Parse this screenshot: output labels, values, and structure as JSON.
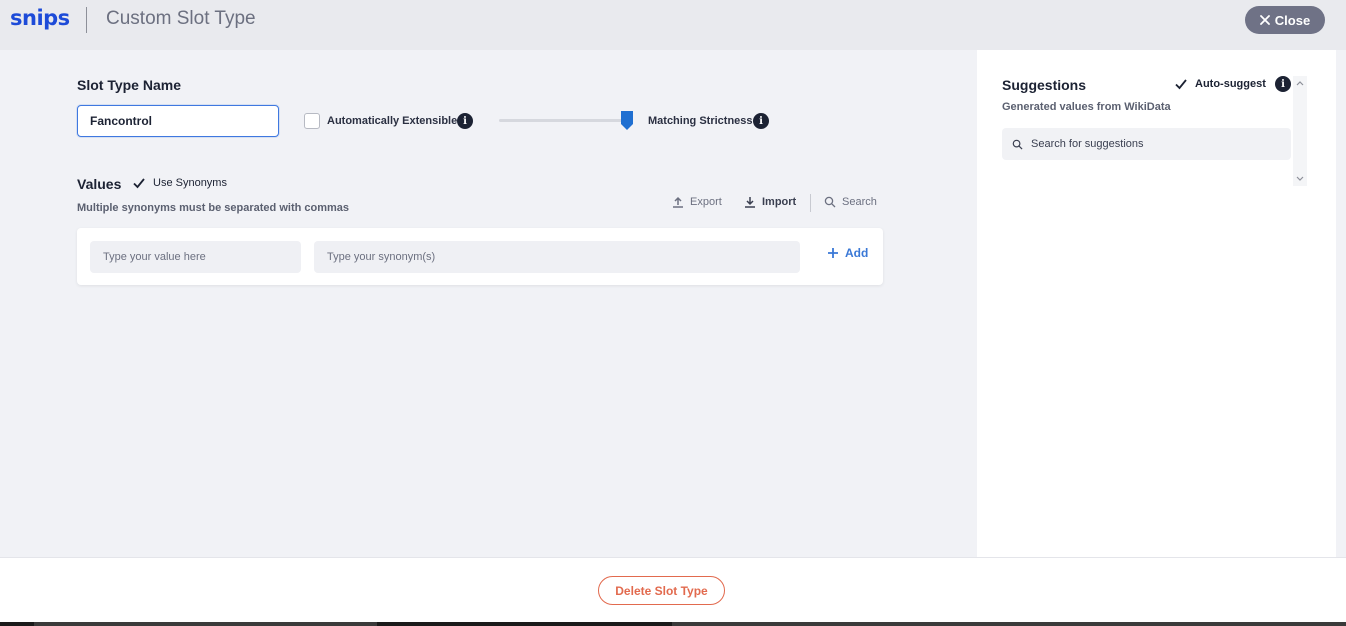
{
  "header": {
    "logo": "snips",
    "title": "Custom Slot Type",
    "close_label": "Close"
  },
  "slot_type": {
    "name_label": "Slot Type Name",
    "name_value": "Fancontrol",
    "auto_extensible_label": "Automatically Extensible",
    "auto_extensible_checked": false,
    "matching_strictness_label": "Matching Strictness",
    "matching_strictness_value": 1.0
  },
  "values": {
    "label": "Values",
    "use_synonyms_label": "Use Synonyms",
    "use_synonyms_checked": true,
    "hint": "Multiple synonyms must be separated with commas",
    "toolbar": {
      "export_label": "Export",
      "import_label": "Import",
      "search_label": "Search"
    },
    "value_placeholder": "Type your value here",
    "synonym_placeholder": "Type your synonym(s)",
    "add_label": "Add"
  },
  "suggestions": {
    "title": "Suggestions",
    "auto_suggest_label": "Auto-suggest",
    "auto_suggest_checked": true,
    "subtitle": "Generated values from WikiData",
    "search_placeholder": "Search for suggestions"
  },
  "footer": {
    "delete_label": "Delete Slot Type"
  },
  "colors": {
    "brand": "#1d4bd8",
    "accent": "#3a78d6",
    "danger": "#e26a4e",
    "slider": "#1f6fd1"
  }
}
